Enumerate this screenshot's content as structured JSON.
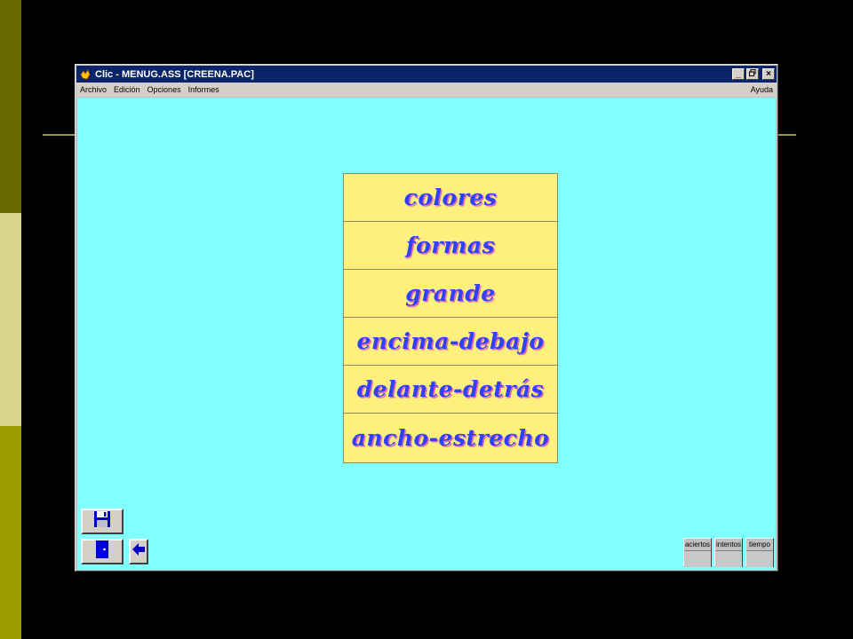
{
  "window": {
    "title": "Clic - MENUG.ASS [CREENA.PAC]",
    "buttons": {
      "minimize": "_",
      "restore": "□",
      "close": "×"
    }
  },
  "menu": {
    "items": [
      "Archivo",
      "Edición",
      "Opciones",
      "Informes"
    ],
    "help": "Ayuda"
  },
  "words": [
    "colores",
    "formas",
    "grande",
    "encima-debajo",
    "delante-detrás",
    "ancho-estrecho"
  ],
  "counters": {
    "aciertos": {
      "label": "aciertos",
      "value": ""
    },
    "intentos": {
      "label": "intentos",
      "value": ""
    },
    "tiempo": {
      "label": "tiempo",
      "value": ""
    }
  },
  "icons": {
    "app": "clic-app-icon",
    "save": "floppy-disk-icon",
    "exit": "exit-door-icon",
    "back": "arrow-left-icon"
  },
  "colors": {
    "background": "#80ffff",
    "cell": "#fff07e",
    "word": "#3040ff",
    "word_shadow": "#e86aa8",
    "titlebar": "#0a246a"
  }
}
